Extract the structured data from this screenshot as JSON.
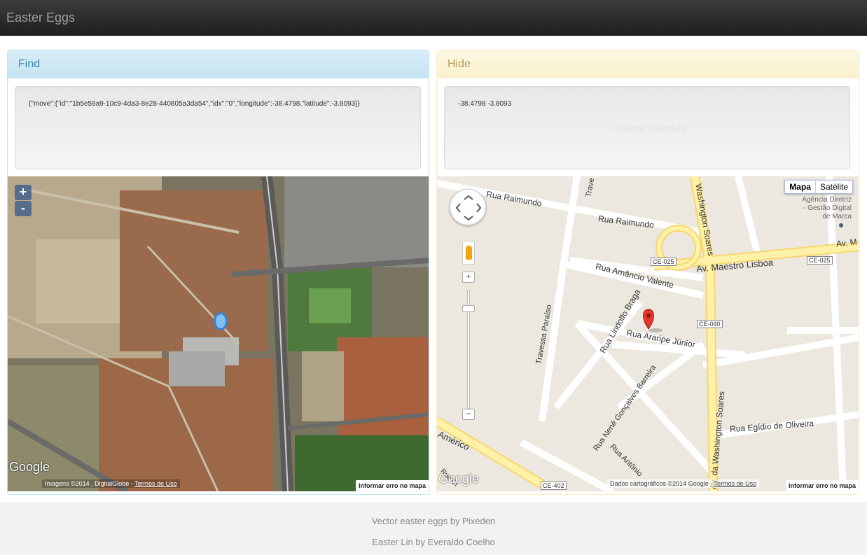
{
  "navbar": {
    "brand": "Easter Eggs"
  },
  "find": {
    "title": "Find",
    "json_text": "{\"move\":{\"id\":\"1b5e59a9-10c9-4da3-8e28-440805a3da54\",\"idx\":\"0\",\"longitude\":-38.4798,\"latitude\":-3.8093}}",
    "zoom_in": "+",
    "zoom_out": "-",
    "google": "Google",
    "attribution": "Imagens ©2014 , DigitalGlobe -",
    "terms": "Termos de Uso",
    "report": "Informar erro no mapa"
  },
  "hide": {
    "title": "Hide",
    "coords": "-38.4798 -3.8093",
    "ghost_button": "Captura Retangular",
    "maptype": {
      "map": "Mapa",
      "satellite": "Satélite"
    },
    "poi": [
      "Agência Diretriz",
      "- Gestão Digital",
      "de Marca"
    ],
    "streets": [
      "Rua Raimundo",
      "Rua Raimundo",
      "Trave",
      "Washington Soares",
      "Av. M",
      "CE-025",
      "CE-025",
      "Av. Maestro Lisboa",
      "Rua Amâncio Valente",
      "CE-040",
      "Rua Lindolfo Braga",
      "Rua Araripe Júnior",
      "Travessa Paraíso",
      "Rua Nenê Gonçalves Barreira",
      "Rua Egídio de Oliveira",
      "Américo",
      "Rua Antônio",
      "Rua Cl",
      "Av. da Washington Soares",
      "CE-402"
    ],
    "zoom_plus": "+",
    "zoom_minus": "−",
    "google": "Google",
    "attribution": "Dados cartográficos ©2014 Google -",
    "terms": "Termos de Uso",
    "report": "Informar erro no mapa"
  },
  "footer": {
    "credit1": "Vector easter eggs by Pixeden",
    "credit2": "Easter Lin by Everaldo Coelho"
  }
}
